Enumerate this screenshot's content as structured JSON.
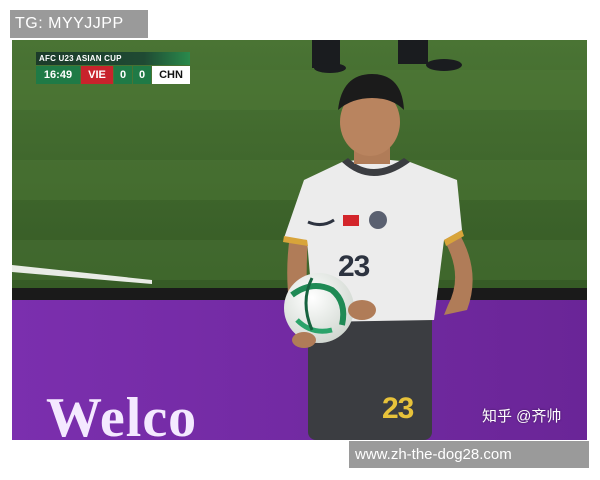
{
  "overlay": {
    "tg_label": "TG: MYYJJPP",
    "url_label": "www.zh-the-dog28.com",
    "zhihu_watermark": "知乎 @齐帅"
  },
  "scoreboard": {
    "tournament": "AFC U23 ASIAN CUP",
    "clock": "16:49",
    "team_home": "VIE",
    "score_home": "0",
    "score_away": "0",
    "team_away": "CHN"
  },
  "scene": {
    "ad_board_text": "Welco",
    "jersey_number": "23",
    "shorts_number": "23"
  },
  "colors": {
    "pitch": "#3f6a2c",
    "ad_board": "#7a2fa8",
    "home_red": "#c8232c",
    "bug_green": "#1f7a46"
  }
}
